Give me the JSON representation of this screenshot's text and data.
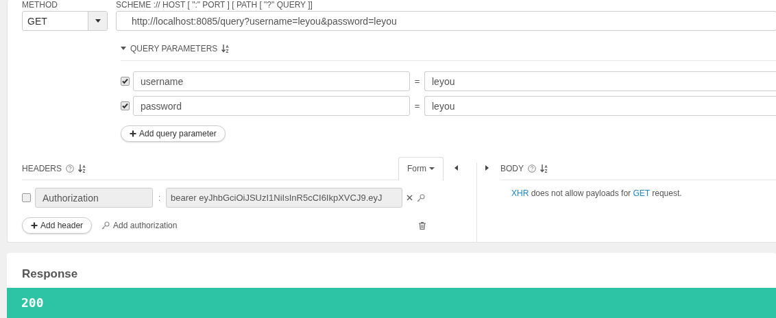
{
  "method": {
    "label": "METHOD",
    "value": "GET"
  },
  "url": {
    "label": "SCHEME :// HOST [ \":\" PORT ] [ PATH [ \"?\" QUERY ]]",
    "value": "http://localhost:8085/query?username=leyou&password=leyou"
  },
  "query_parameters": {
    "title": "QUERY PARAMETERS",
    "expanded": true,
    "params": [
      {
        "checked": true,
        "name": "username",
        "separator": "=",
        "value": "leyou"
      },
      {
        "checked": true,
        "name": "password",
        "separator": "=",
        "value": "leyou"
      }
    ],
    "add_button": "Add query parameter"
  },
  "headers": {
    "title": "HEADERS",
    "mode": "Form",
    "items": [
      {
        "checked": false,
        "name": "Authorization",
        "separator": ":",
        "value": "bearer eyJhbGciOiJSUzI1NiIsInR5cCI6IkpXVCJ9.eyJ"
      }
    ],
    "add_button": "Add header",
    "auth_link": "Add authorization"
  },
  "body": {
    "title": "BODY",
    "message": [
      {
        "kind": "link",
        "text": "XHR"
      },
      {
        "kind": "plain",
        "text": " does not allow payloads for "
      },
      {
        "kind": "link",
        "text": "GET"
      },
      {
        "kind": "plain",
        "text": " request."
      }
    ]
  },
  "response": {
    "title": "Response",
    "status": "200"
  }
}
